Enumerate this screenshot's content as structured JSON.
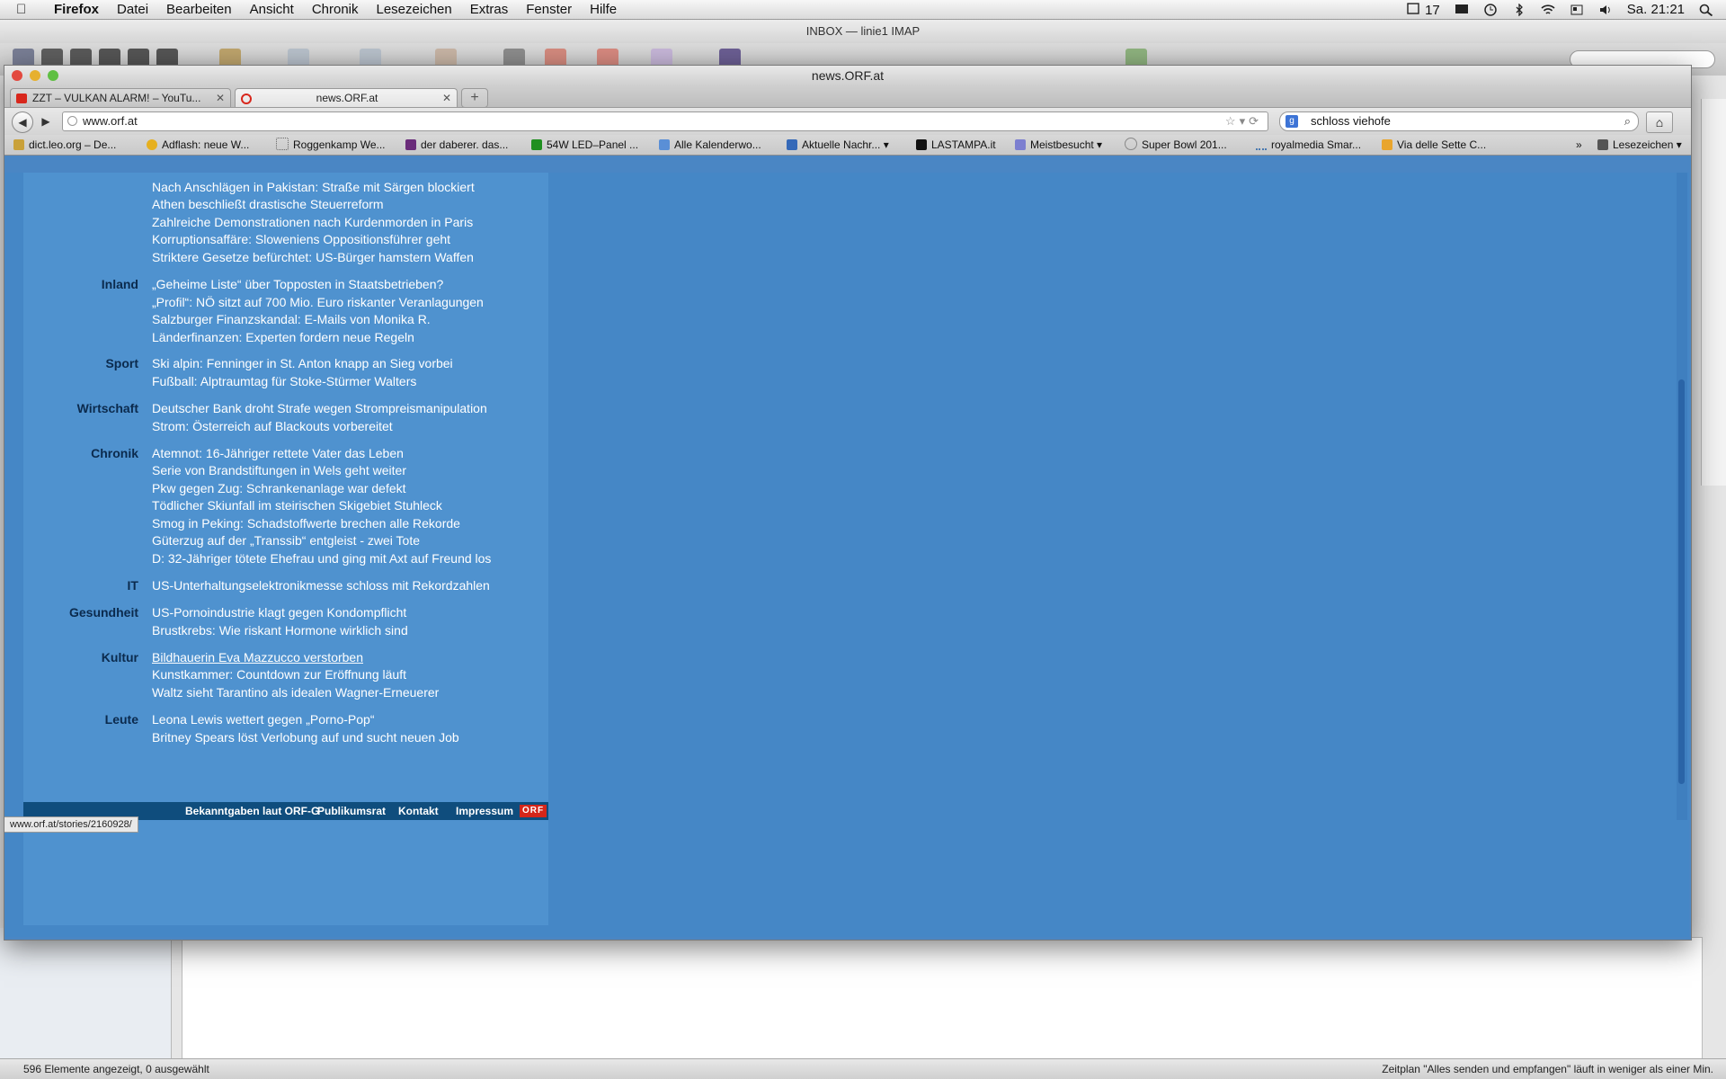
{
  "menubar": {
    "apple": "",
    "items": [
      "Firefox",
      "Datei",
      "Bearbeiten",
      "Ansicht",
      "Chronik",
      "Lesezeichen",
      "Extras",
      "Fenster",
      "Hilfe"
    ],
    "status": {
      "badge": "17",
      "clock": "Sa. 21:21"
    }
  },
  "mail": {
    "title": "INBOX — linie1 IMAP",
    "status_left": "596 Elemente angezeigt, 0 ausgewählt",
    "status_right": "Zeitplan \"Alles senden und empfangen\" läuft in weniger als einer Min."
  },
  "firefox": {
    "window_title": "news.ORF.at",
    "tabs": [
      {
        "title": "ZZT – VULKAN ALARM! – YouTu...",
        "active": false
      },
      {
        "title": "news.ORF.at",
        "active": true
      }
    ],
    "new_tab": "+",
    "url": "www.orf.at",
    "search": "schloss viehofe",
    "bookmarks": [
      "dict.leo.org – De...",
      "Adflash: neue W...",
      "Roggenkamp We...",
      "der daberer. das...",
      "54W LED–Panel ...",
      "Alle Kalenderwo...",
      "Aktuelle Nachr...",
      "LASTAMPA.it",
      "Meistbesucht",
      "Super Bowl 201...",
      "royalmedia Smar...",
      "Via delle Sette C...",
      "Lesezeichen"
    ],
    "status_url": "www.orf.at/stories/2160928/"
  },
  "news": {
    "top": [
      "Nach Anschlägen in Pakistan: Straße mit Särgen blockiert",
      "Athen beschließt drastische Steuerreform",
      "Zahlreiche Demonstrationen nach Kurdenmorden in Paris",
      "Korruptionsaffäre: Sloweniens Oppositionsführer geht",
      "Striktere Gesetze befürchtet: US-Bürger hamstern Waffen"
    ],
    "inland": {
      "label": "Inland",
      "items": [
        "„Geheime Liste“ über Topposten in Staatsbetrieben?",
        "„Profil“: NÖ sitzt auf 700 Mio. Euro riskanter Veranlagungen",
        "Salzburger Finanzskandal: E-Mails von Monika R.",
        "Länderfinanzen: Experten fordern neue Regeln"
      ]
    },
    "sport": {
      "label": "Sport",
      "items": [
        "Ski alpin: Fenninger in St. Anton knapp an Sieg vorbei",
        "Fußball: Alptraumtag für Stoke-Stürmer Walters"
      ]
    },
    "wirtschaft": {
      "label": "Wirtschaft",
      "items": [
        "Deutscher Bank droht Strafe wegen Strompreismanipulation",
        "Strom: Österreich auf Blackouts vorbereitet"
      ]
    },
    "chronik": {
      "label": "Chronik",
      "items": [
        "Atemnot: 16-Jähriger rettete Vater das Leben",
        "Serie von Brandstiftungen in Wels geht weiter",
        "Pkw gegen Zug: Schrankenanlage war defekt",
        "Tödlicher Skiunfall im steirischen Skigebiet Stuhleck",
        "Smog in Peking: Schadstoffwerte brechen alle Rekorde",
        "Güterzug auf der „Transsib“ entgleist - zwei Tote",
        "D: 32-Jähriger tötete Ehefrau und ging mit Axt auf Freund los"
      ]
    },
    "it": {
      "label": "IT",
      "items": [
        "US-Unterhaltungselektronikmesse schloss mit Rekordzahlen"
      ]
    },
    "gesundheit": {
      "label": "Gesundheit",
      "items": [
        "US-Pornoindustrie klagt gegen Kondompflicht",
        "Brustkrebs: Wie riskant Hormone wirklich sind"
      ]
    },
    "kultur": {
      "label": "Kultur",
      "items": [
        "Bildhauerin Eva Mazzucco verstorben",
        "Kunstkammer: Countdown zur Eröffnung läuft",
        "Waltz sieht Tarantino als idealen Wagner-Erneuerer"
      ]
    },
    "leute": {
      "label": "Leute",
      "items": [
        "Leona Lewis wettert gegen „Porno-Pop“",
        "Britney Spears löst Verlobung auf und sucht neuen Job"
      ]
    }
  },
  "footer": {
    "links": [
      "Bekanntgaben laut ORF-G",
      "Publikumsrat",
      "Kontakt",
      "Impressum"
    ],
    "logo": "ORF"
  },
  "colors": {
    "page_bg": "#4587c6",
    "column_bg": "#4f92cf",
    "footer_bg": "#0f4d7d",
    "label_color": "#0b2a4d",
    "logo_red": "#d5261a"
  }
}
